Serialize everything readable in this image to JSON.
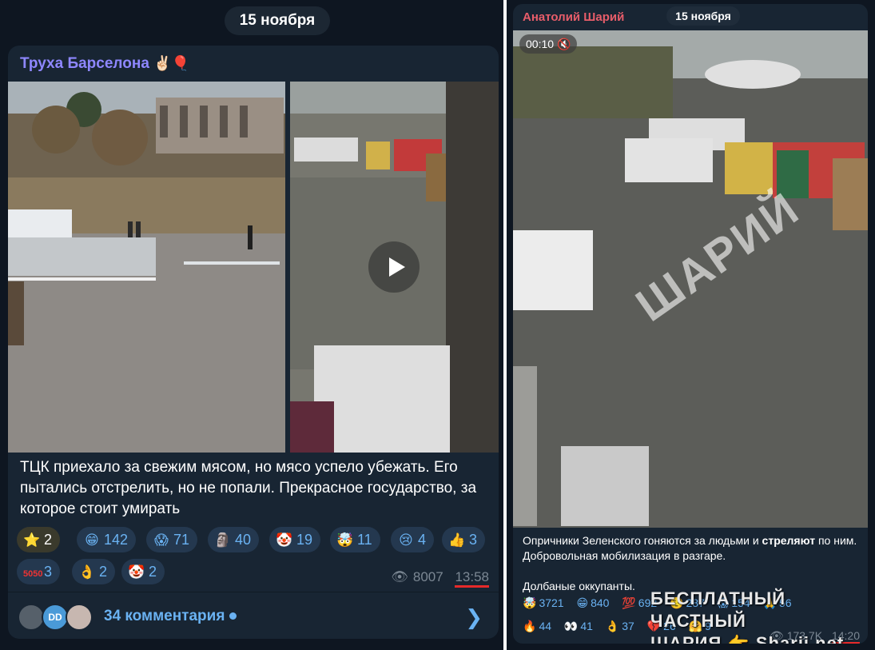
{
  "left": {
    "date": "15 ноября",
    "channel": "Труха Барселона",
    "channel_emoji": "✌🏻🎈",
    "caption": "ТЦК приехало за свежим мясом, но мясо успело убежать. Его пытались отстрелить, но не попали. Прекрасное государство, за которое стоит умирать",
    "reactions": [
      {
        "emoji": "⭐",
        "count": "2",
        "selected": true
      },
      {
        "emoji": "😁",
        "count": "142"
      },
      {
        "emoji": "😱",
        "count": "71"
      },
      {
        "emoji": "🗿",
        "count": "40"
      },
      {
        "emoji": "🤡",
        "count": "19"
      },
      {
        "emoji": "🤯",
        "count": "11"
      },
      {
        "emoji": "😢",
        "count": "4"
      },
      {
        "emoji": "👍",
        "count": "3"
      },
      {
        "emoji": "5050",
        "count": "3"
      },
      {
        "emoji": "👌",
        "count": "2"
      },
      {
        "emoji": "🤡",
        "count": "2"
      }
    ],
    "views": "8007",
    "time": "13:58",
    "comments": "34 комментария",
    "avatar_initials": "DD",
    "colors": {
      "accent": "#6ab2f2",
      "author": "#8e87ff",
      "underline": "#e62a2a"
    }
  },
  "right": {
    "channel": "Анатолий Шарий",
    "date": "15 ноября",
    "video_time": "00:10",
    "watermark": "ШАРИЙ",
    "caption_before": "Опричники Зеленского гоняются за людьми и ",
    "caption_bold": "стреляют",
    "caption_after": " по ним. Добровольная мобилизация в разгаре.",
    "caption_line2": "Долбаные оккупанты.",
    "reactions_row1": [
      {
        "emoji": "🤯",
        "count": "3721"
      },
      {
        "emoji": "😁",
        "count": "840"
      },
      {
        "emoji": "💯",
        "count": "692"
      },
      {
        "emoji": "🤨",
        "count": "287"
      },
      {
        "emoji": "😱",
        "count": "154"
      },
      {
        "emoji": "🙏",
        "count": "56"
      }
    ],
    "reactions_row2": [
      {
        "emoji": "🔥",
        "count": "44"
      },
      {
        "emoji": "👀",
        "count": "41"
      },
      {
        "emoji": "👌",
        "count": "37"
      },
      {
        "emoji": "💔",
        "count": "26"
      },
      {
        "emoji": "🤗",
        "count": "9"
      }
    ],
    "views": "173.7K",
    "time": "14:20",
    "overlay_line1": "БЕСПЛАТНЫЙ ЧАСТНЫЙ",
    "overlay_line2": "ШАРИЯ 👉 Sharij.net",
    "colors": {
      "author": "#e85d6a"
    }
  }
}
